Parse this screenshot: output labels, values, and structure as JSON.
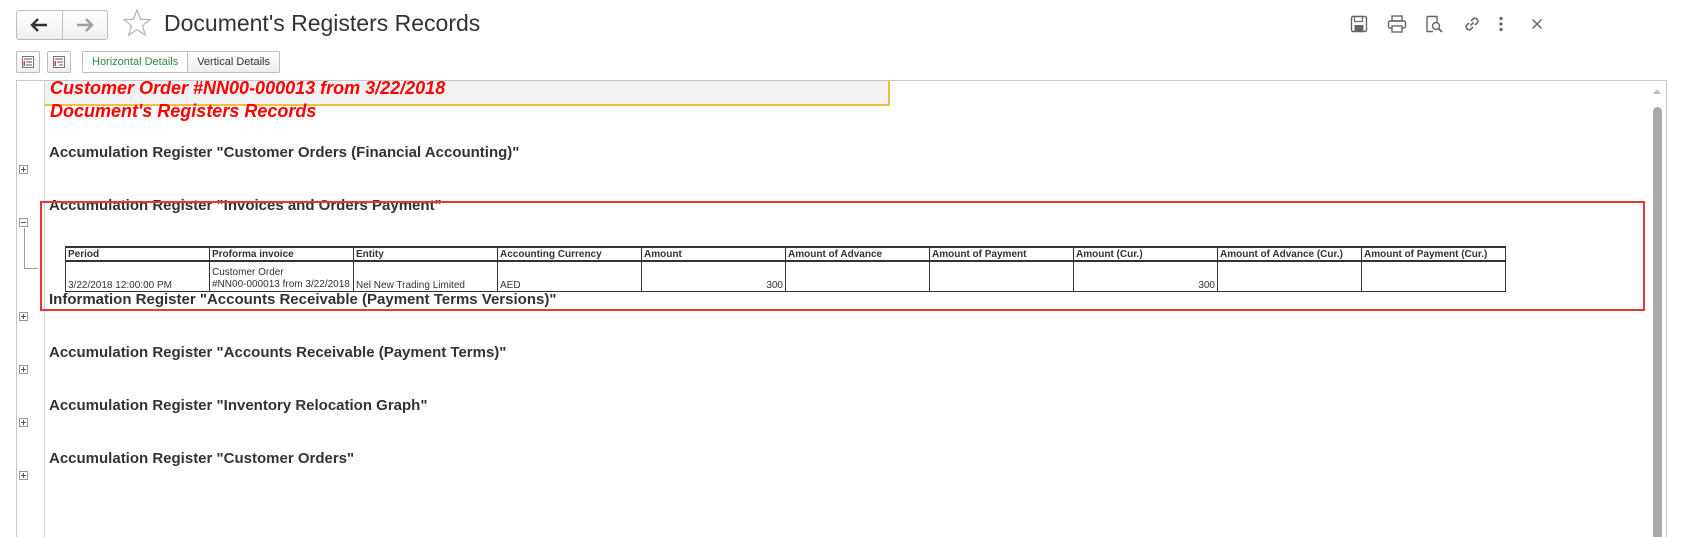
{
  "window": {
    "title": "Document's Registers Records"
  },
  "toolbar": {
    "view_tabs": [
      {
        "label": "Horizontal Details",
        "active": true
      },
      {
        "label": "Vertical Details",
        "active": false
      }
    ]
  },
  "report": {
    "header_line1": "Customer Order #NN00-000013 from 3/22/2018",
    "header_line2": "Document's Registers Records",
    "sections": [
      {
        "title": "Accumulation Register \"Customer Orders (Financial Accounting)\"",
        "expanded": false
      },
      {
        "title": "Accumulation Register \"Invoices and Orders Payment\"",
        "expanded": true
      },
      {
        "title": "Information Register \"Accounts Receivable (Payment Terms Versions)\"",
        "expanded": false
      },
      {
        "title": "Accumulation Register \"Accounts Receivable (Payment Terms)\"",
        "expanded": false
      },
      {
        "title": "Accumulation Register \"Inventory Relocation Graph\"",
        "expanded": false
      },
      {
        "title": "Accumulation Register \"Customer Orders\"",
        "expanded": false
      }
    ],
    "table": {
      "columns": [
        "Period",
        "Proforma invoice",
        "Entity",
        "Accounting Currency",
        "Amount",
        "Amount of Advance",
        "Amount of Payment",
        "Amount (Cur.)",
        "Amount of Advance (Cur.)",
        "Amount of Payment (Cur.)"
      ],
      "row": {
        "period": "3/22/2018 12:00:00 PM",
        "proforma_line1": "Customer Order",
        "proforma_line2": "#NN00-000013 from 3/22/2018",
        "entity": "Nel New Trading Limited",
        "currency": "AED",
        "amount": "300",
        "amount_advance": "",
        "amount_payment": "",
        "amount_cur": "300",
        "amount_advance_cur": "",
        "amount_payment_cur": ""
      }
    }
  },
  "icons": {
    "back": "arrow-left-icon",
    "forward": "arrow-right-icon",
    "favorite": "star-icon",
    "save": "floppy-disk-icon",
    "print": "printer-icon",
    "preview": "print-preview-icon",
    "link": "link-icon",
    "more": "more-vertical-icon",
    "close": "close-icon"
  },
  "colors": {
    "header_text": "#ff0000",
    "header_border": "#f0c040",
    "selection_border": "#e53935",
    "active_tab": "#2c8a3a"
  }
}
